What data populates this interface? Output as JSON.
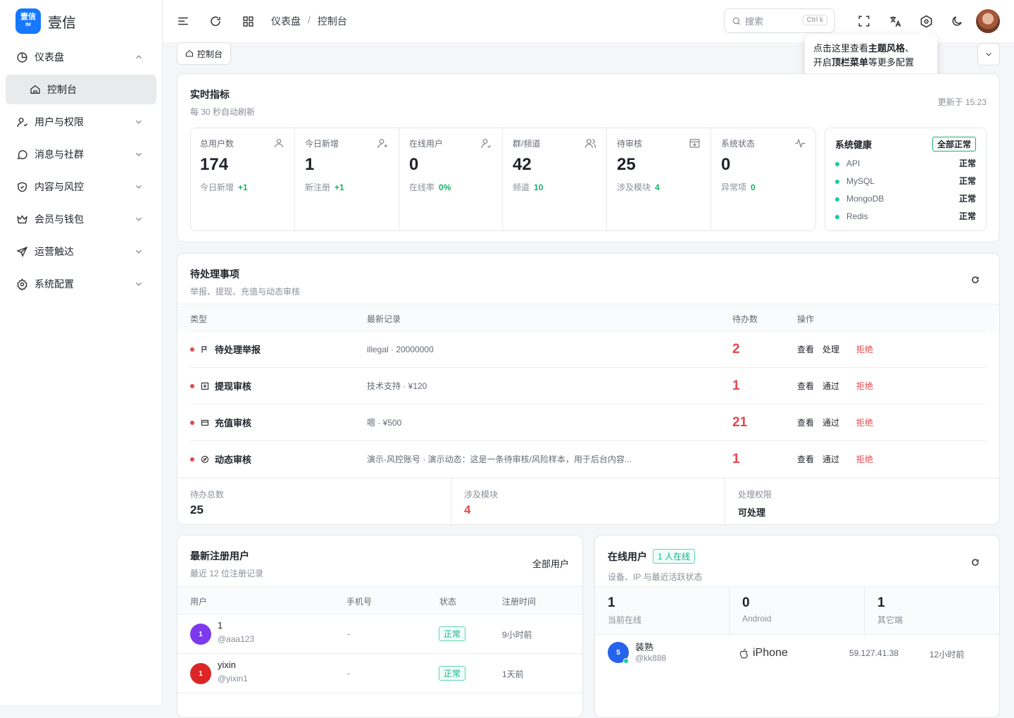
{
  "app": {
    "logo_mark": "壹信",
    "logo_sub": "IM",
    "name": "壹信"
  },
  "sidebar": {
    "items": [
      {
        "label": "仪表盘",
        "icon": "pie-chart-icon",
        "expanded": true
      },
      {
        "label": "用户与权限",
        "icon": "user-icon"
      },
      {
        "label": "消息与社群",
        "icon": "chat-bubble-icon"
      },
      {
        "label": "内容与风控",
        "icon": "shield-check-icon"
      },
      {
        "label": "会员与钱包",
        "icon": "crown-icon"
      },
      {
        "label": "运营触达",
        "icon": "send-icon"
      },
      {
        "label": "系统配置",
        "icon": "gear-icon"
      }
    ],
    "sub": {
      "label": "控制台",
      "icon": "home-icon"
    }
  },
  "topbar": {
    "breadcrumb": [
      "仪表盘",
      "/",
      "控制台"
    ],
    "search_placeholder": "搜索",
    "search_kbd": "Ctrl k"
  },
  "tab": {
    "label": "控制台"
  },
  "tooltip": {
    "pre": "点击这里查看",
    "b1": "主题风格",
    "mid": "、\n开启",
    "b2": "顶栏菜单",
    "post": "等更多配置"
  },
  "realtime": {
    "title": "实时指标",
    "subtitle": "每 30 秒自动刷新",
    "updated": "更新于 15:23",
    "metrics": [
      {
        "label": "总用户数",
        "value": "174",
        "sub": "今日新增",
        "delta": "+1",
        "icon": "user-icon"
      },
      {
        "label": "今日新增",
        "value": "1",
        "sub": "新注册",
        "delta": "+1",
        "icon": "user-plus-icon"
      },
      {
        "label": "在线用户",
        "value": "0",
        "sub": "在线率",
        "delta": "0%",
        "icon": "user-check-icon"
      },
      {
        "label": "群/频道",
        "value": "42",
        "sub": "频道",
        "delta": "10",
        "icon": "users-icon"
      },
      {
        "label": "待审核",
        "value": "25",
        "sub": "涉及模块",
        "delta": "4",
        "icon": "inbox-icon"
      },
      {
        "label": "系统状态",
        "value": "0",
        "sub": "异常项",
        "delta": "0",
        "icon": "activity-icon"
      }
    ],
    "health": {
      "title": "系统健康",
      "badge": "全部正常",
      "rows": [
        {
          "name": "API",
          "status": "正常"
        },
        {
          "name": "MySQL",
          "status": "正常"
        },
        {
          "name": "MongoDB",
          "status": "正常"
        },
        {
          "name": "Redis",
          "status": "正常"
        }
      ]
    }
  },
  "pending": {
    "title": "待处理事项",
    "subtitle": "举报、提现、充值与动态审核",
    "headers": [
      "类型",
      "最新记录",
      "待办数",
      "操作"
    ],
    "rows": [
      {
        "type": "待处理举报",
        "record": "illegal · 20000000",
        "count": "2",
        "op1": "查看",
        "op2": "处理",
        "op3": "拒绝",
        "icon": "flag-icon"
      },
      {
        "type": "提现审核",
        "record": "技术支持 · ¥120",
        "count": "1",
        "op1": "查看",
        "op2": "通过",
        "op3": "拒绝",
        "icon": "withdraw-icon"
      },
      {
        "type": "充值审核",
        "record": "嗯 · ¥500",
        "count": "21",
        "op1": "查看",
        "op2": "通过",
        "op3": "拒绝",
        "icon": "card-icon"
      },
      {
        "type": "动态审核",
        "record": "演示-风控账号 · 演示动态：这是一条待审核/风险样本，用于后台内容...",
        "count": "1",
        "op1": "查看",
        "op2": "通过",
        "op3": "拒绝",
        "icon": "compass-icon"
      }
    ],
    "footer": [
      {
        "label": "待办总数",
        "value": "25"
      },
      {
        "label": "涉及模块",
        "value": "4"
      },
      {
        "label": "处理权限",
        "value": "可处理"
      }
    ]
  },
  "new_users": {
    "title": "最新注册用户",
    "subtitle": "最近 12 位注册记录",
    "link": "全部用户",
    "headers": [
      "用户",
      "手机号",
      "状态",
      "注册时间"
    ],
    "rows": [
      {
        "avatar": "1",
        "name": "1",
        "handle": "@aaa123",
        "phone": "-",
        "status": "正常",
        "time": "9小时前",
        "color": "#7c3aed"
      },
      {
        "avatar": "1",
        "name": "yixin",
        "handle": "@yixin1",
        "phone": "-",
        "status": "正常",
        "time": "1天前",
        "color": "#dc2626"
      }
    ]
  },
  "online": {
    "title": "在线用户",
    "badge": "1 人在线",
    "subtitle": "设备、IP 与最近活跃状态",
    "stats": [
      {
        "value": "1",
        "label": "当前在线"
      },
      {
        "value": "0",
        "label": "Android"
      },
      {
        "value": "1",
        "label": "其它端"
      }
    ],
    "row": {
      "avatar": "5",
      "name": "装熟",
      "handle": "@kk888",
      "device": "iPhone",
      "ip": "59.127.41.38",
      "time": "12小时前"
    }
  }
}
